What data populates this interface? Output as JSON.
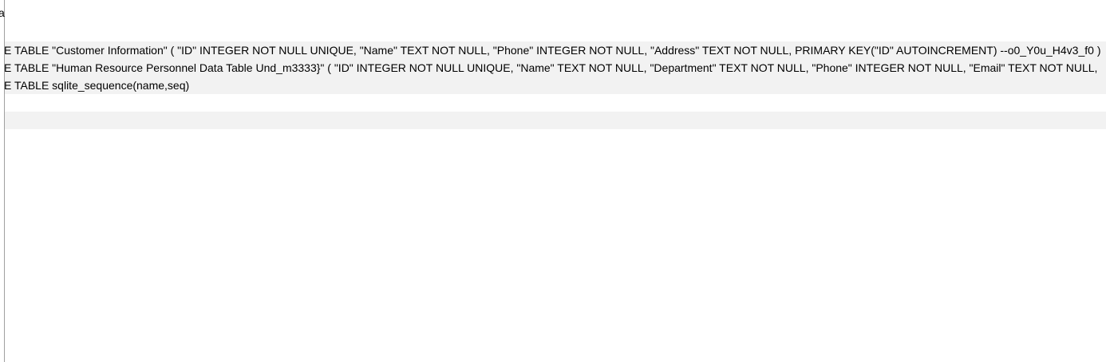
{
  "header": {
    "column_label": "a"
  },
  "rows": [
    {
      "sql": "E TABLE \"Customer Information\" ( \"ID\" INTEGER NOT NULL UNIQUE, \"Name\" TEXT NOT NULL, \"Phone\" INTEGER NOT NULL, \"Address\" TEXT NOT NULL, PRIMARY KEY(\"ID\" AUTOINCREMENT) --o0_Y0u_H4v3_f0 )"
    },
    {
      "sql": "E TABLE \"Human Resource Personnel Data Table Und_m3333}\" ( \"ID\" INTEGER NOT NULL UNIQUE, \"Name\" TEXT NOT NULL, \"Department\" TEXT NOT NULL, \"Phone\" INTEGER NOT NULL, \"Email\" TEXT NOT NULL,"
    },
    {
      "sql": "E TABLE sqlite_sequence(name,seq)"
    },
    {
      "sql": ""
    },
    {
      "sql": ""
    }
  ]
}
